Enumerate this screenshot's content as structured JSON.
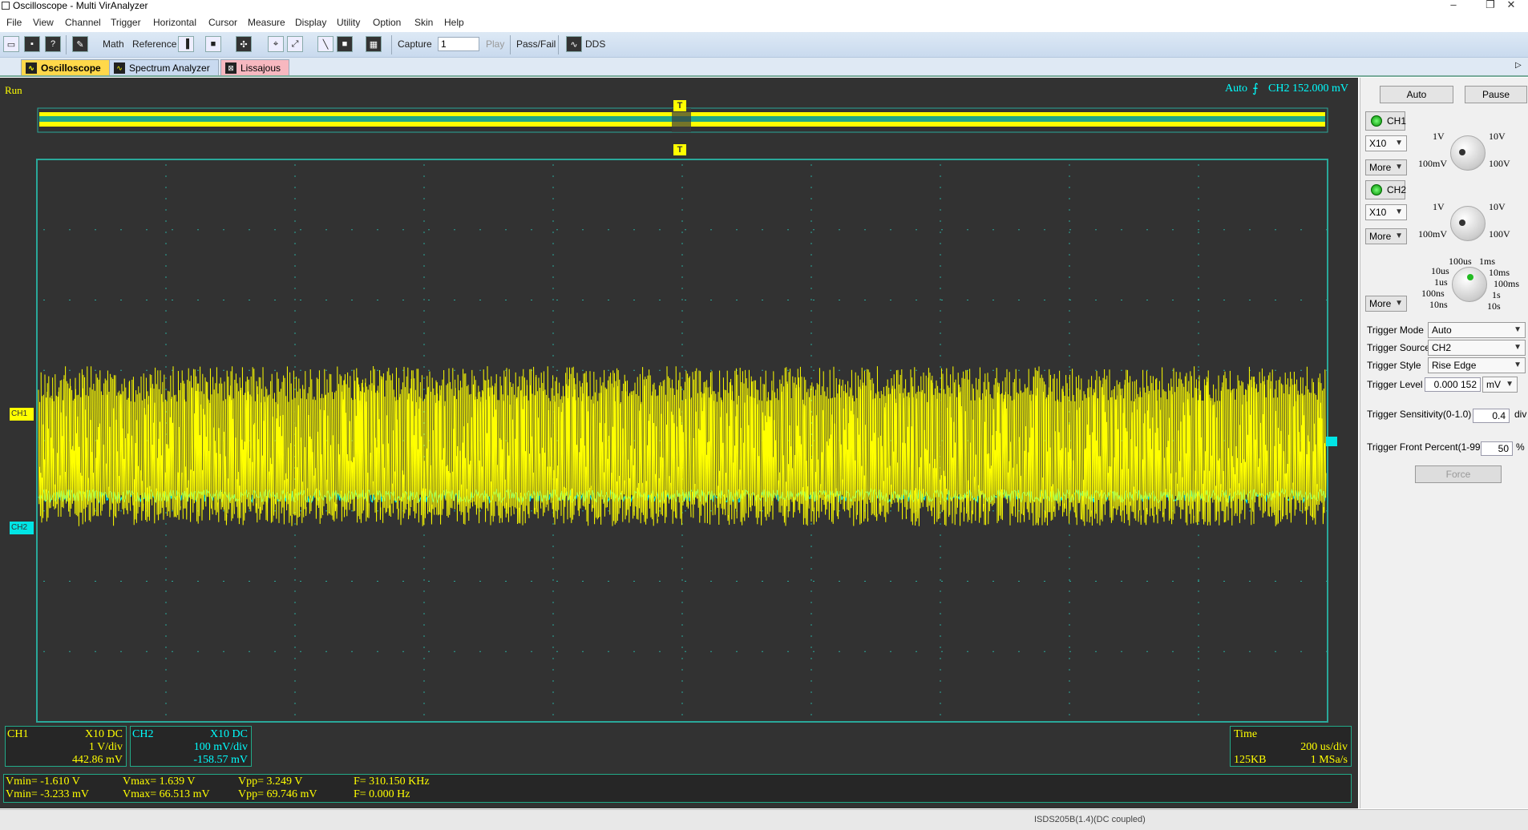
{
  "window": {
    "title": "Oscilloscope - Multi VirAnalyzer",
    "min": "–",
    "restore": "❐",
    "close": "✕"
  },
  "menu": [
    "File",
    "View",
    "Channel",
    "Trigger",
    "Horizontal",
    "Cursor",
    "Measure",
    "Display",
    "Utility",
    "Option",
    "Skin",
    "Help"
  ],
  "toolbar": {
    "math": "Math",
    "reference": "Reference",
    "capture": "Capture",
    "capture_value": "1",
    "play": "Play",
    "passfail": "Pass/Fail",
    "dds": "DDS"
  },
  "tabs": [
    {
      "label": "Oscilloscope",
      "icon": "scope-icon"
    },
    {
      "label": "Spectrum Analyzer",
      "icon": "spectrum-icon"
    },
    {
      "label": "Lissajous",
      "icon": "lissajous-icon"
    }
  ],
  "scope": {
    "status": "Run",
    "trigger_info": "Auto",
    "trigger_channel": "CH2 152.000 mV",
    "ch1_marker": "CH1",
    "ch2_marker": "CH2",
    "trig_marker": "T",
    "colors": {
      "ch1": "#ffff00",
      "ch2": "#00e5e5",
      "bg": "#323232",
      "grid": "#2aa89a"
    },
    "ch1_info": {
      "name": "CH1",
      "probe": "X10  DC",
      "vdiv": "1 V/div",
      "offset": "442.86 mV"
    },
    "ch2_info": {
      "name": "CH2",
      "probe": "X10  DC",
      "vdiv": "100 mV/div",
      "offset": "-158.57 mV"
    },
    "time_info": {
      "label": "Time",
      "tdiv": "200 us/div",
      "mem": "125KB",
      "rate": "1 MSa/s"
    },
    "meas_ch1": {
      "vmin": "Vmin= -1.610 V",
      "vmax": "Vmax= 1.639 V",
      "vpp": "Vpp= 3.249 V",
      "freq": "F= 310.150 KHz"
    },
    "meas_ch2": {
      "vmin": "Vmin= -3.233 mV",
      "vmax": "Vmax= 66.513 mV",
      "vpp": "Vpp= 69.746 mV",
      "freq": "F= 0.000 Hz"
    }
  },
  "right": {
    "auto": "Auto",
    "pause": "Pause",
    "ch1": {
      "label": "CH1",
      "probe": "X10",
      "more": "More",
      "k1": "1V",
      "k2": "10V",
      "k3": "100mV",
      "k4": "100V"
    },
    "ch2": {
      "label": "CH2",
      "probe": "X10",
      "more": "More",
      "k1": "1V",
      "k2": "10V",
      "k3": "100mV",
      "k4": "100V"
    },
    "time": {
      "more": "More",
      "labels": [
        "100us",
        "1ms",
        "10us",
        "10ms",
        "1us",
        "100ms",
        "100ns",
        "1s",
        "10ns",
        "10s"
      ]
    },
    "trigger_mode": {
      "label": "Trigger Mode",
      "value": "Auto"
    },
    "trigger_source": {
      "label": "Trigger Source",
      "value": "CH2"
    },
    "trigger_style": {
      "label": "Trigger Style",
      "value": "Rise Edge"
    },
    "trigger_level": {
      "label": "Trigger Level",
      "value": "0.000 152",
      "unit": "mV"
    },
    "sensitivity": {
      "label": "Trigger Sensitivity(0-1.0)",
      "value": "0.4",
      "unit": "div"
    },
    "front": {
      "label": "Trigger Front Percent(1-99)",
      "value": "50",
      "unit": "%"
    },
    "force": "Force"
  },
  "status": {
    "text": "ISDS205B(1.4)(DC coupled)"
  }
}
